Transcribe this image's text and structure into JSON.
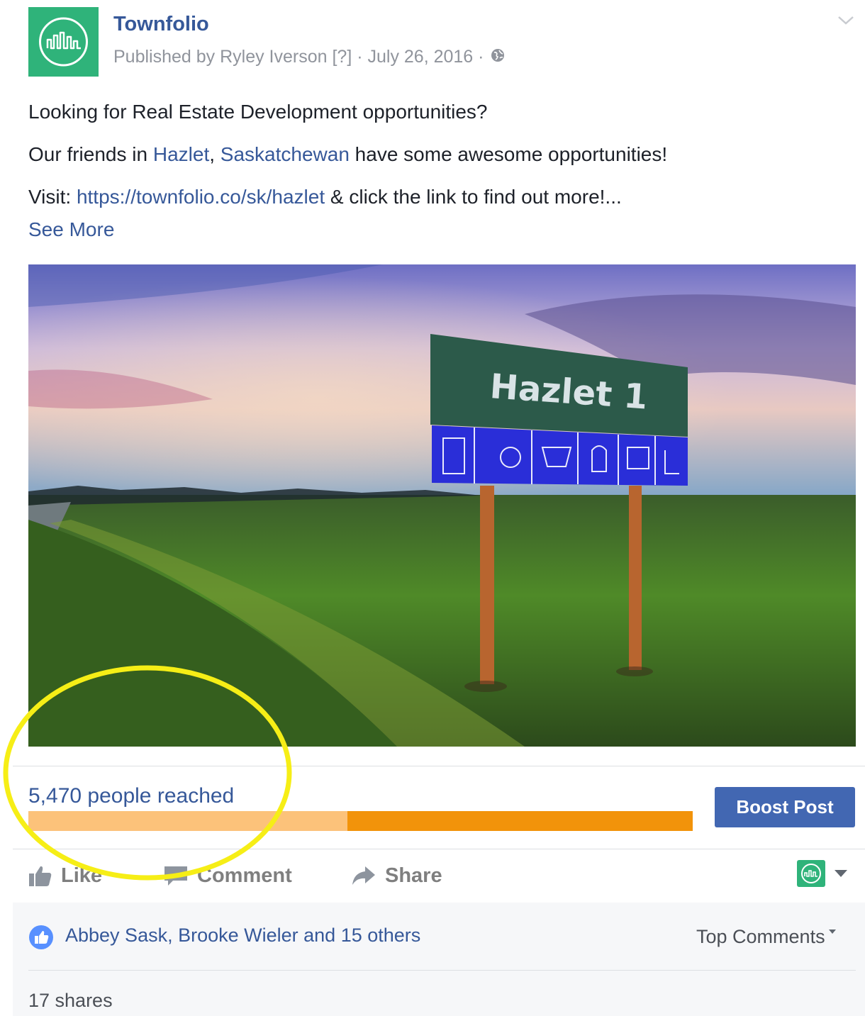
{
  "post": {
    "page_name": "Townfolio",
    "meta": {
      "published_by": "Published by Ryley Iverson [?] · July 26, 2016 ·",
      "privacy_icon": "globe-icon"
    },
    "text": {
      "line1": "Looking for Real Estate Development opportunities?",
      "line2_start": "Our friends in ",
      "line2_link1": "Hazlet",
      "line2_sep": ", ",
      "line2_link2": "Saskatchewan",
      "line2_end": " have some awesome opportunities!",
      "line3_start": "Visit: ",
      "line3_link": "https://townfolio.co/sk/hazlet",
      "line3_end": " & click the link to find out more!...",
      "see_more": "See More"
    },
    "photo": {
      "sign_text": "Hazlet 1"
    }
  },
  "insights": {
    "reach_label": "5,470 people reached",
    "organic_fraction": 0.48,
    "boost_label": "Boost Post"
  },
  "actions": {
    "like": "Like",
    "comment": "Comment",
    "share": "Share"
  },
  "footer": {
    "likers": "Abbey Sask, Brooke Wieler and 15 others",
    "top_comments": "Top Comments",
    "shares": "17 shares"
  },
  "colors": {
    "brand_green": "#2fb37a",
    "link_blue": "#365899",
    "boost_blue": "#4267b2",
    "reach_organic": "#fcc27a",
    "reach_paid": "#f2930a",
    "highlight": "#f6ee16"
  }
}
